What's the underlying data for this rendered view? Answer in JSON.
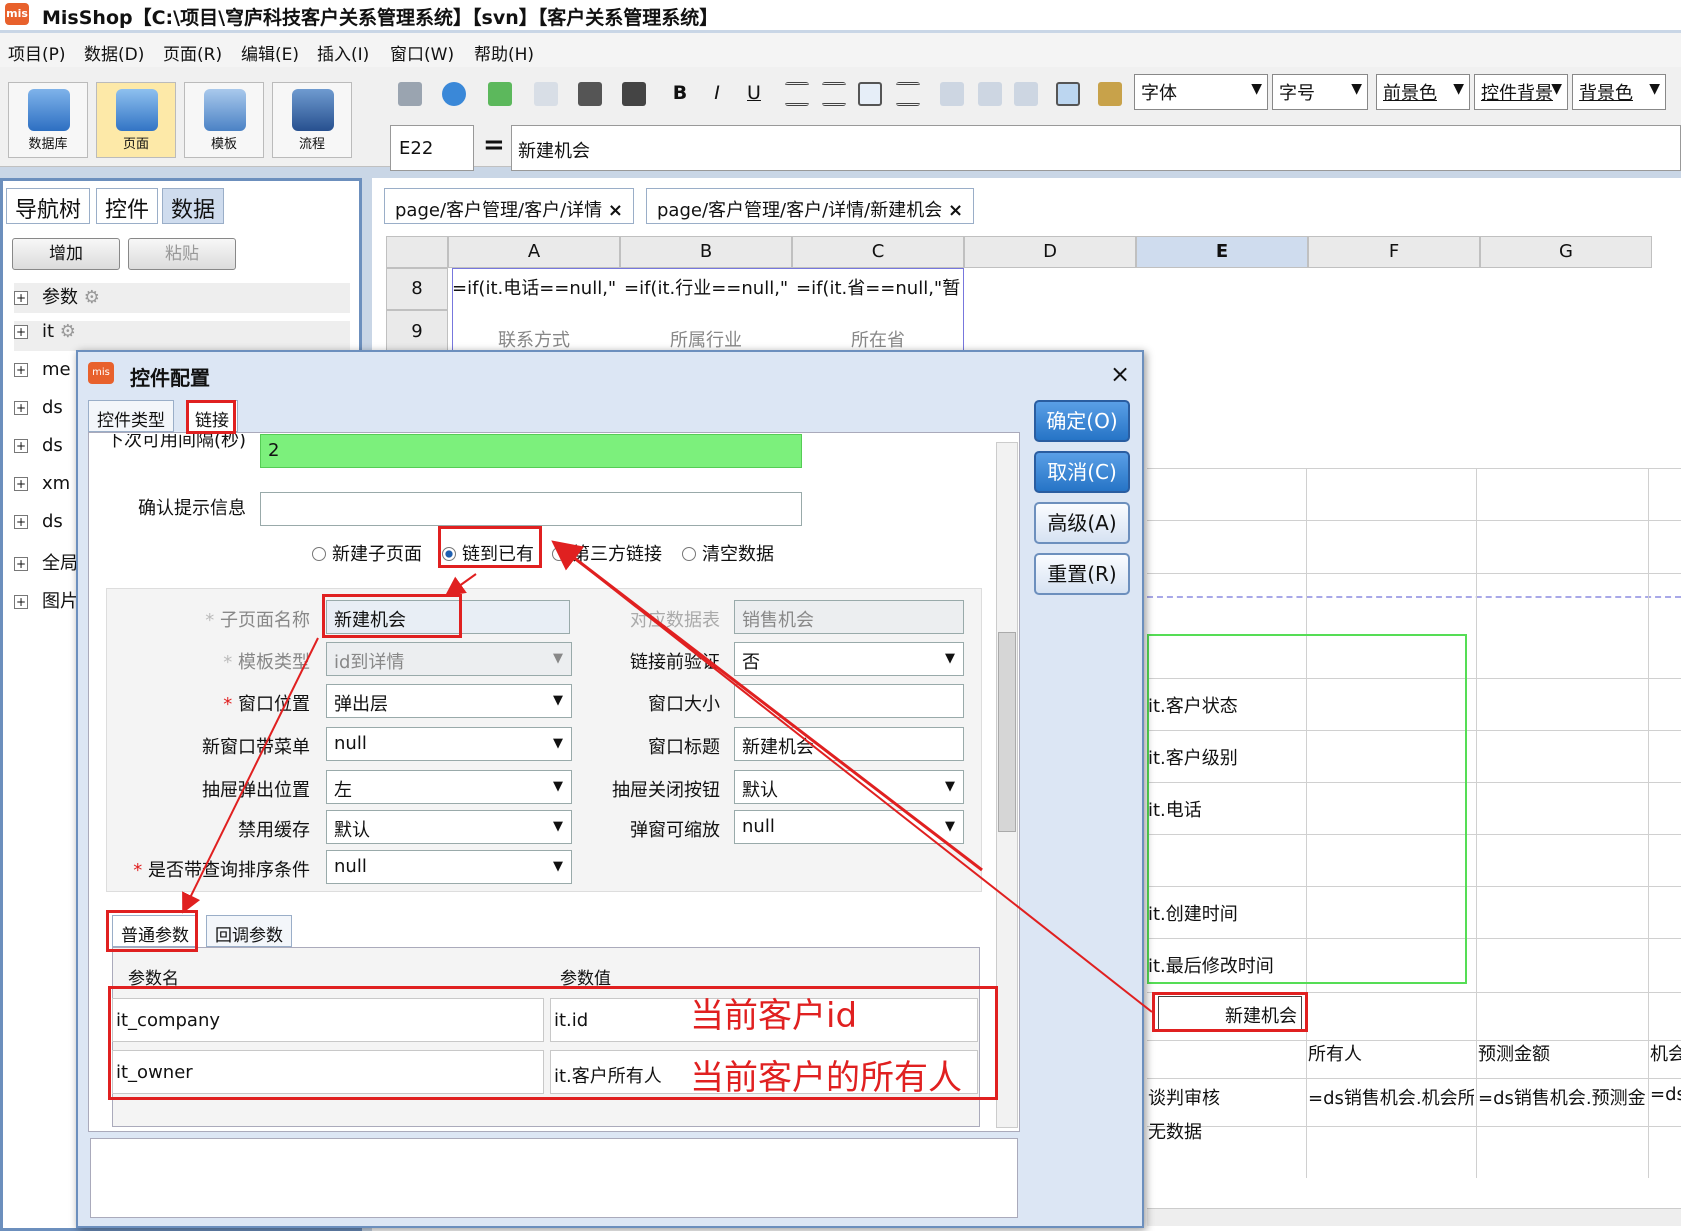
{
  "app": {
    "icon_text": "mis",
    "title": "MisShop【C:\\项目\\穹庐科技客户关系管理系统】【svn】【客户关系管理系统】"
  },
  "menu": [
    "项目(P)",
    "数据(D)",
    "页面(R)",
    "编辑(E)",
    "插入(I)",
    "窗口(W)",
    "帮助(H)"
  ],
  "ribbon": {
    "buttons": [
      {
        "label": "数据库",
        "icon": "database-icon"
      },
      {
        "label": "页面",
        "icon": "page-icon"
      },
      {
        "label": "模板",
        "icon": "template-icon"
      },
      {
        "label": "流程",
        "icon": "flow-icon"
      }
    ],
    "format_buttons": {
      "bold": "B",
      "italic": "I",
      "underline": "U"
    },
    "combos": {
      "font": "字体",
      "size": "字号",
      "fg": "前景色",
      "ctrl_bg": "控件背景",
      "bg": "背景色"
    }
  },
  "formula": {
    "cell_ref": "E22",
    "equals": "=",
    "value": "新建机会"
  },
  "left_panel": {
    "tabs": [
      "导航树",
      "控件",
      "数据"
    ],
    "add": "增加",
    "paste": "粘贴",
    "tree": [
      "参数",
      "it",
      "me",
      "ds",
      "ds",
      "xm",
      "ds",
      "全局",
      "图片"
    ]
  },
  "editor": {
    "tabs": [
      "page/客户管理/客户/详情",
      "page/客户管理/客户/详情/新建机会"
    ],
    "tab_close": "×",
    "columns": [
      "A",
      "B",
      "C",
      "D",
      "E",
      "F",
      "G"
    ],
    "rows": [
      "8",
      "9"
    ],
    "row8": [
      "=if(it.电话==null,\"",
      "=if(it.行业==null,\"",
      "=if(it.省==null,\"暂"
    ],
    "row9": [
      "联系方式",
      "所属行业",
      "所在省"
    ],
    "fields": [
      "it.客户状态",
      "it.客户级别",
      "it.电话",
      "it.创建时间",
      "it.最后修改时间"
    ],
    "btn_cell": "新建机会",
    "header_row": [
      "所有人",
      "预测金额",
      "机会"
    ],
    "formula_row": [
      "谈判审核",
      "=ds销售机会.机会所",
      "=ds销售机会.预测金",
      "=ds"
    ],
    "no_data": "无数据"
  },
  "dialog": {
    "icon_text": "mis",
    "title": "控件配置",
    "close": "×",
    "tabs": [
      "控件类型",
      "链接"
    ],
    "buttons": [
      "确定(O)",
      "取消(C)",
      "高级(A)",
      "重置(R)"
    ],
    "interval_label": "下次可用间隔(秒)",
    "interval_value": "2",
    "confirm_label": "确认提示信息",
    "confirm_value": "",
    "radios": [
      "新建子页面",
      "链到已有",
      "第三方链接",
      "清空数据"
    ],
    "star": "*",
    "form": {
      "subpage_label": "子页面名称",
      "subpage_value": "新建机会",
      "table_label": "对应数据表",
      "table_value": "销售机会",
      "template_label": "模板类型",
      "template_value": "id到详情",
      "verify_label": "链接前验证",
      "verify_value": "否",
      "winpos_label": "窗口位置",
      "winpos_value": "弹出层",
      "winsize_label": "窗口大小",
      "winsize_value": "",
      "menu_label": "新窗口带菜单",
      "menu_value": "null",
      "wintitle_label": "窗口标题",
      "wintitle_value": "新建机会",
      "drawer_label": "抽屉弹出位置",
      "drawer_value": "左",
      "drawerclose_label": "抽屉关闭按钮",
      "drawerclose_value": "默认",
      "cache_label": "禁用缓存",
      "cache_value": "默认",
      "zoom_label": "弹窗可缩放",
      "zoom_value": "null",
      "sort_label": "是否带查询排序条件",
      "sort_value": "null"
    },
    "param_tabs": [
      "普通参数",
      "回调参数"
    ],
    "param_headers": [
      "参数名",
      "参数值"
    ],
    "params": [
      {
        "name": "it_company",
        "value": "it.id"
      },
      {
        "name": "it_owner",
        "value": "it.客户所有人"
      }
    ],
    "annotations": [
      "当前客户id",
      "当前客户的所有人"
    ]
  },
  "colors": {
    "accent": "#e02020",
    "primary": "#2674c6",
    "brand": "#e8612c"
  }
}
